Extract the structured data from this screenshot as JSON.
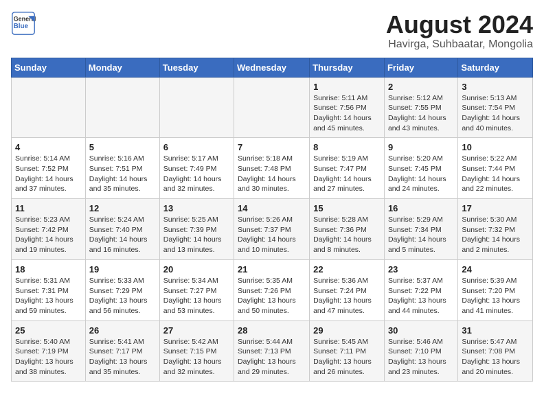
{
  "logo": {
    "line1": "General",
    "line2": "Blue"
  },
  "title": "August 2024",
  "subtitle": "Havirga, Suhbaatar, Mongolia",
  "days_of_week": [
    "Sunday",
    "Monday",
    "Tuesday",
    "Wednesday",
    "Thursday",
    "Friday",
    "Saturday"
  ],
  "weeks": [
    [
      {
        "num": "",
        "detail": ""
      },
      {
        "num": "",
        "detail": ""
      },
      {
        "num": "",
        "detail": ""
      },
      {
        "num": "",
        "detail": ""
      },
      {
        "num": "1",
        "detail": "Sunrise: 5:11 AM\nSunset: 7:56 PM\nDaylight: 14 hours\nand 45 minutes."
      },
      {
        "num": "2",
        "detail": "Sunrise: 5:12 AM\nSunset: 7:55 PM\nDaylight: 14 hours\nand 43 minutes."
      },
      {
        "num": "3",
        "detail": "Sunrise: 5:13 AM\nSunset: 7:54 PM\nDaylight: 14 hours\nand 40 minutes."
      }
    ],
    [
      {
        "num": "4",
        "detail": "Sunrise: 5:14 AM\nSunset: 7:52 PM\nDaylight: 14 hours\nand 37 minutes."
      },
      {
        "num": "5",
        "detail": "Sunrise: 5:16 AM\nSunset: 7:51 PM\nDaylight: 14 hours\nand 35 minutes."
      },
      {
        "num": "6",
        "detail": "Sunrise: 5:17 AM\nSunset: 7:49 PM\nDaylight: 14 hours\nand 32 minutes."
      },
      {
        "num": "7",
        "detail": "Sunrise: 5:18 AM\nSunset: 7:48 PM\nDaylight: 14 hours\nand 30 minutes."
      },
      {
        "num": "8",
        "detail": "Sunrise: 5:19 AM\nSunset: 7:47 PM\nDaylight: 14 hours\nand 27 minutes."
      },
      {
        "num": "9",
        "detail": "Sunrise: 5:20 AM\nSunset: 7:45 PM\nDaylight: 14 hours\nand 24 minutes."
      },
      {
        "num": "10",
        "detail": "Sunrise: 5:22 AM\nSunset: 7:44 PM\nDaylight: 14 hours\nand 22 minutes."
      }
    ],
    [
      {
        "num": "11",
        "detail": "Sunrise: 5:23 AM\nSunset: 7:42 PM\nDaylight: 14 hours\nand 19 minutes."
      },
      {
        "num": "12",
        "detail": "Sunrise: 5:24 AM\nSunset: 7:40 PM\nDaylight: 14 hours\nand 16 minutes."
      },
      {
        "num": "13",
        "detail": "Sunrise: 5:25 AM\nSunset: 7:39 PM\nDaylight: 14 hours\nand 13 minutes."
      },
      {
        "num": "14",
        "detail": "Sunrise: 5:26 AM\nSunset: 7:37 PM\nDaylight: 14 hours\nand 10 minutes."
      },
      {
        "num": "15",
        "detail": "Sunrise: 5:28 AM\nSunset: 7:36 PM\nDaylight: 14 hours\nand 8 minutes."
      },
      {
        "num": "16",
        "detail": "Sunrise: 5:29 AM\nSunset: 7:34 PM\nDaylight: 14 hours\nand 5 minutes."
      },
      {
        "num": "17",
        "detail": "Sunrise: 5:30 AM\nSunset: 7:32 PM\nDaylight: 14 hours\nand 2 minutes."
      }
    ],
    [
      {
        "num": "18",
        "detail": "Sunrise: 5:31 AM\nSunset: 7:31 PM\nDaylight: 13 hours\nand 59 minutes."
      },
      {
        "num": "19",
        "detail": "Sunrise: 5:33 AM\nSunset: 7:29 PM\nDaylight: 13 hours\nand 56 minutes."
      },
      {
        "num": "20",
        "detail": "Sunrise: 5:34 AM\nSunset: 7:27 PM\nDaylight: 13 hours\nand 53 minutes."
      },
      {
        "num": "21",
        "detail": "Sunrise: 5:35 AM\nSunset: 7:26 PM\nDaylight: 13 hours\nand 50 minutes."
      },
      {
        "num": "22",
        "detail": "Sunrise: 5:36 AM\nSunset: 7:24 PM\nDaylight: 13 hours\nand 47 minutes."
      },
      {
        "num": "23",
        "detail": "Sunrise: 5:37 AM\nSunset: 7:22 PM\nDaylight: 13 hours\nand 44 minutes."
      },
      {
        "num": "24",
        "detail": "Sunrise: 5:39 AM\nSunset: 7:20 PM\nDaylight: 13 hours\nand 41 minutes."
      }
    ],
    [
      {
        "num": "25",
        "detail": "Sunrise: 5:40 AM\nSunset: 7:19 PM\nDaylight: 13 hours\nand 38 minutes."
      },
      {
        "num": "26",
        "detail": "Sunrise: 5:41 AM\nSunset: 7:17 PM\nDaylight: 13 hours\nand 35 minutes."
      },
      {
        "num": "27",
        "detail": "Sunrise: 5:42 AM\nSunset: 7:15 PM\nDaylight: 13 hours\nand 32 minutes."
      },
      {
        "num": "28",
        "detail": "Sunrise: 5:44 AM\nSunset: 7:13 PM\nDaylight: 13 hours\nand 29 minutes."
      },
      {
        "num": "29",
        "detail": "Sunrise: 5:45 AM\nSunset: 7:11 PM\nDaylight: 13 hours\nand 26 minutes."
      },
      {
        "num": "30",
        "detail": "Sunrise: 5:46 AM\nSunset: 7:10 PM\nDaylight: 13 hours\nand 23 minutes."
      },
      {
        "num": "31",
        "detail": "Sunrise: 5:47 AM\nSunset: 7:08 PM\nDaylight: 13 hours\nand 20 minutes."
      }
    ]
  ]
}
